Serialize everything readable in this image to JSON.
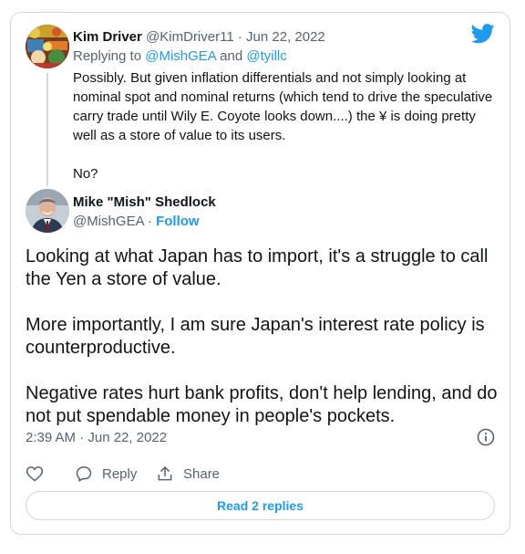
{
  "reply_tweet": {
    "author_name": "Kim Driver",
    "author_handle": "@KimDriver11",
    "separator": "·",
    "date": "Jun 22, 2022",
    "replying_prefix": "Replying to",
    "replying_to_1": "@MishGEA",
    "replying_and": "and",
    "replying_to_2": "@tyillc",
    "text_paragraph_1": "Possibly. But given inflation differentials and not simply looking at nominal spot and nominal returns (which tend to drive the speculative carry trade until Wily E. Coyote looks down....) the ¥ is doing pretty well as a store of value to its users.",
    "text_paragraph_2": "No?"
  },
  "main_tweet": {
    "author_name": "Mike \"Mish\" Shedlock",
    "author_handle": "@MishGEA",
    "separator": "·",
    "follow_label": "Follow",
    "paragraphs": [
      "Looking at what Japan has to import, it's a struggle to call the Yen a store of value.",
      "More importantly, I am sure Japan's interest rate policy is counterproductive.",
      "Negative rates hurt bank profits, don't help lending, and do not put spendable money in people's pockets."
    ],
    "timestamp": "2:39 AM · Jun 22, 2022"
  },
  "actions": {
    "like_icon": "heart-icon",
    "reply_label": "Reply",
    "share_label": "Share"
  },
  "read_replies_label": "Read 2 replies",
  "colors": {
    "accent": "#1d9bf0",
    "text": "#0f1419",
    "muted": "#536471",
    "border": "#cfd9de"
  }
}
